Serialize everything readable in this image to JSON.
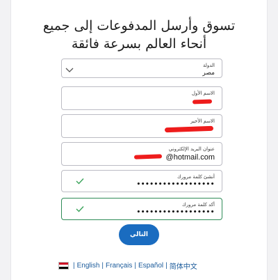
{
  "title": "تسوق وأرسل المدفوعات إلى جميع أنحاء العالم بسرعة فائقة",
  "form": {
    "country": {
      "label": "الدولة",
      "value": "مصر"
    },
    "first_name": {
      "label": "الاسم الأول"
    },
    "last_name": {
      "label": "الاسم الأخير"
    },
    "email": {
      "label": "عنوان البريد الإلكتروني",
      "value": "@hotmail.com"
    },
    "password": {
      "label": "أنشئ كلمة مرورك",
      "value": "••••••••••••••••••"
    },
    "confirm_password": {
      "label": "أكد كلمة مرورك",
      "value": "••••••••••••••••••"
    }
  },
  "next_button": "التالي",
  "languages": {
    "items": [
      "English",
      "Français",
      "Español",
      "简体中文"
    ],
    "separator": "|"
  },
  "colors": {
    "primary_button": "#1a6cc0",
    "valid_check": "#3aa35a",
    "focus_border": "#2e8b57",
    "redaction": "#ee1c1c"
  }
}
